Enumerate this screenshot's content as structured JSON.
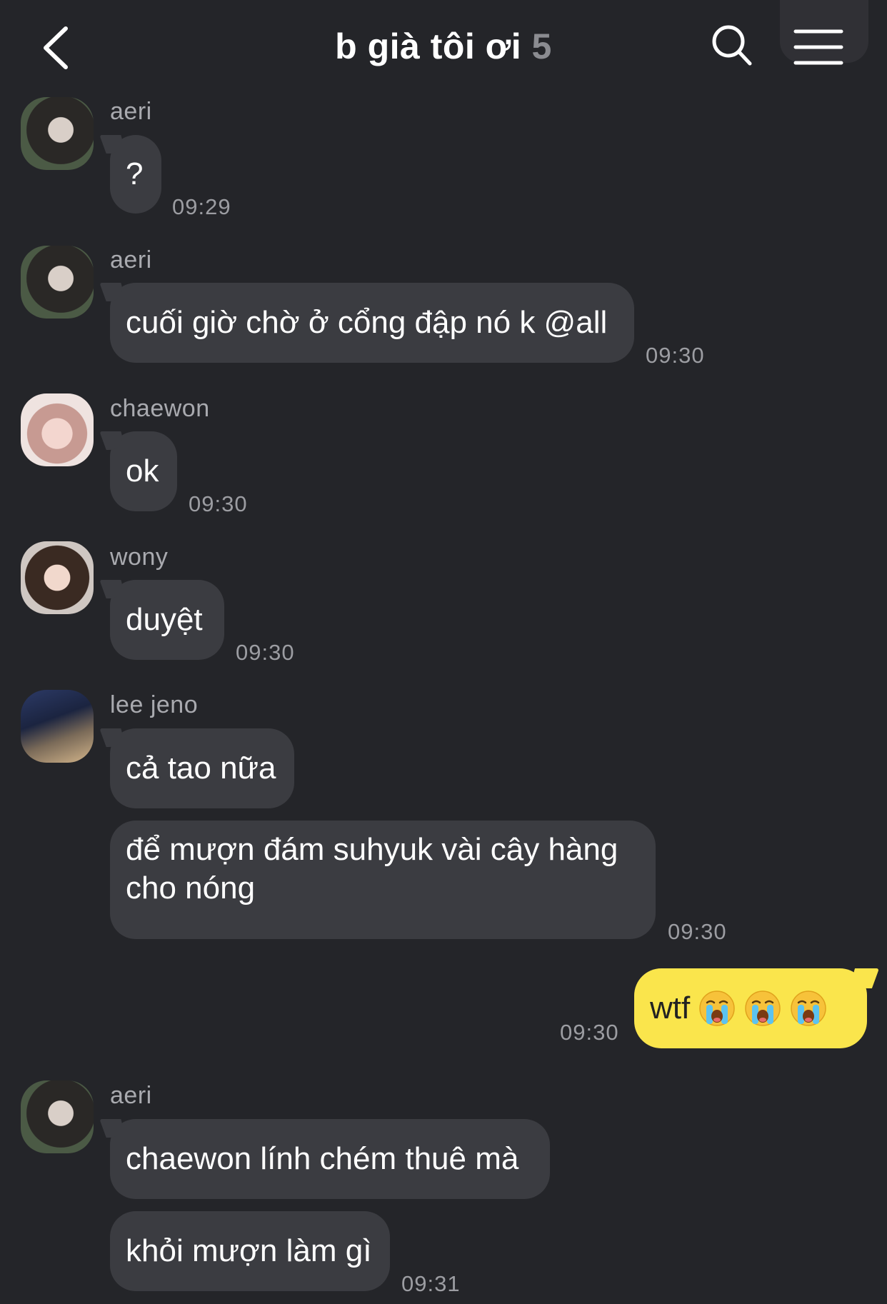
{
  "header": {
    "title": "b già tôi ơi",
    "member_count": "5",
    "back_icon": "chevron-left-icon",
    "search_icon": "search-icon",
    "menu_icon": "hamburger-menu-icon"
  },
  "colors": {
    "background": "#242529",
    "incoming_bubble": "#3b3c41",
    "outgoing_bubble": "#fae54c",
    "timestamp": "#9c9da2",
    "sender_name": "#a9aaaf"
  },
  "messages": [
    {
      "sender": "aeri",
      "text": "?",
      "time": "09:29"
    },
    {
      "sender": "aeri",
      "text": "cuối giờ chờ ở cổng đập nó k @all",
      "time": "09:30"
    },
    {
      "sender": "chaewon",
      "text": "ok",
      "time": "09:30"
    },
    {
      "sender": "wony",
      "text": "duyệt",
      "time": "09:30"
    },
    {
      "sender": "lee jeno",
      "text": "cả tao nữa"
    },
    {
      "text": "để mượn đám suhyuk vài cây hàng cho nóng",
      "time": "09:30"
    },
    {
      "mine": true,
      "text": "wtf",
      "emoji": "loudly-crying-face-icon",
      "time": "09:30"
    },
    {
      "sender": "aeri",
      "text": "chaewon lính chém thuê mà"
    },
    {
      "text": "khỏi mượn làm gì",
      "time": "09:31"
    }
  ]
}
